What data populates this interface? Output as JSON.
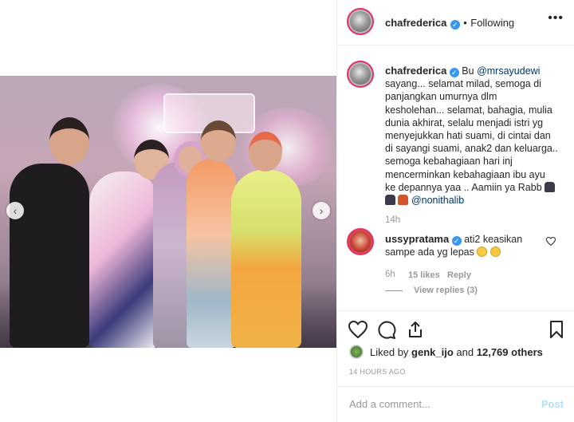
{
  "header": {
    "username": "chafrederica",
    "separator": "•",
    "follow_status": "Following",
    "more_label": "•••"
  },
  "caption": {
    "username": "chafrederica",
    "line1_prefix": "Bu",
    "mention1": "@mrsayudewi",
    "body_lines": [
      "sayang... selamat milad, semoga di",
      "panjangkan umurnya dlm",
      "kesholehan... selamat, bahagia, mulia",
      "dunia akhirat, selalu menjadi istri yg",
      "menyejukkan hati suami, di cintai dan",
      "di sayangi suami, anak2 dan keluarga..",
      "semoga kebahagiaan hari inj",
      "mencerminkan kebahagiaan ibu ayu",
      "ke depannya yaa .. Aamiin ya Rabb"
    ],
    "mention2": "@nonithalib",
    "time": "14h"
  },
  "comment": {
    "username": "ussypratama",
    "line1": "ati2 keasikan",
    "line2": "sampe ada yg lepas",
    "time": "6h",
    "likes": "15 likes",
    "reply": "Reply",
    "view_replies": "View replies (3)"
  },
  "likes": {
    "prefix": "Liked by",
    "user": "genk_ijo",
    "middle": "and",
    "count": "12,769 others"
  },
  "timestamp": "14 HOURS AGO",
  "add_comment": {
    "placeholder": "Add a comment...",
    "post_label": "Post"
  },
  "media_nav": {
    "prev": "‹",
    "next": "›"
  },
  "colors": {
    "verified": "#3897f0",
    "link": "#003569",
    "muted": "#999999",
    "post_disabled": "#b2dffc"
  }
}
